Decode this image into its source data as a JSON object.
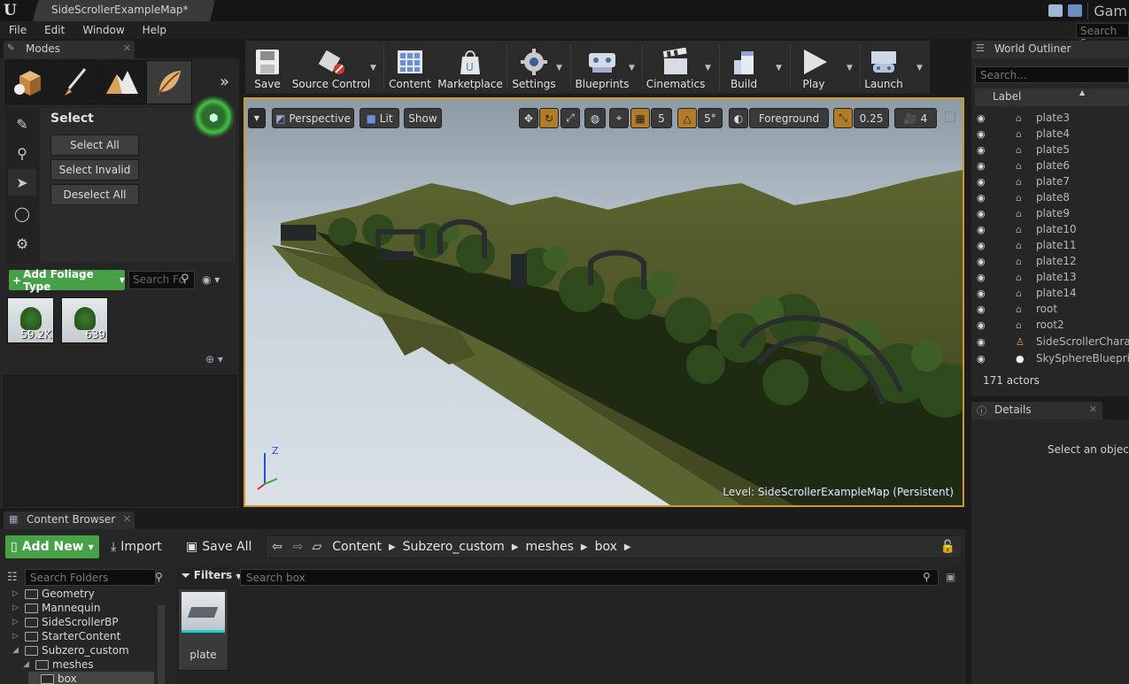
{
  "title_bar": {
    "logo_icon": "unreal-engine-logo",
    "document_tab": "SideScrollerExampleMap*",
    "game_label": "Gam"
  },
  "menu": [
    "File",
    "Edit",
    "Window",
    "Help"
  ],
  "search_for_placeholder": "Search Fo",
  "modes": {
    "tab_label": "Modes",
    "select_title": "Select",
    "buttons": [
      "Select All",
      "Select Invalid",
      "Deselect All"
    ],
    "add_foliage_label": "Add Foliage Type",
    "foliage_search_placeholder": "Search Fo",
    "foliage_items": [
      {
        "count": "59.2K"
      },
      {
        "count": "639"
      }
    ]
  },
  "toolbar": [
    {
      "label": "Save",
      "icon": "save-icon"
    },
    {
      "label": "Source Control",
      "icon": "source-control-icon"
    },
    {
      "label": "Content",
      "icon": "content-icon"
    },
    {
      "label": "Marketplace",
      "icon": "marketplace-icon"
    },
    {
      "label": "Settings",
      "icon": "settings-icon"
    },
    {
      "label": "Blueprints",
      "icon": "blueprints-icon"
    },
    {
      "label": "Cinematics",
      "icon": "cinematics-icon"
    },
    {
      "label": "Build",
      "icon": "build-icon"
    },
    {
      "label": "Play",
      "icon": "play-icon"
    },
    {
      "label": "Launch",
      "icon": "launch-icon"
    }
  ],
  "viewport": {
    "perspective": "Perspective",
    "lit": "Lit",
    "show": "Show",
    "grid_snap": "5",
    "rotation_snap": "5°",
    "layer": "Foreground",
    "scale_snap": "0.25",
    "camera_speed": "4",
    "level_label": "Level:",
    "level_name": "SideScrollerExampleMap (Persistent)",
    "axis_z": "Z"
  },
  "world_outliner": {
    "tab_label": "World Outliner",
    "search_placeholder": "Search...",
    "column_label": "Label",
    "items": [
      "plate3",
      "plate4",
      "plate5",
      "plate6",
      "plate7",
      "plate8",
      "plate9",
      "plate10",
      "plate11",
      "plate12",
      "plate13",
      "plate14",
      "root",
      "root2",
      "SideScrollerCharact",
      "SkySphereBlueprint"
    ],
    "count": "171 actors"
  },
  "details": {
    "tab_label": "Details",
    "message": "Select an object t"
  },
  "content_browser": {
    "tab_label": "Content Browser",
    "add_new": "Add New",
    "import": "Import",
    "save_all": "Save All",
    "breadcrumbs": [
      "Content",
      "Subzero_custom",
      "meshes",
      "box"
    ],
    "folder_search_placeholder": "Search Folders",
    "folders": [
      {
        "name": "Geometry",
        "depth": 0,
        "expanded": false
      },
      {
        "name": "Mannequin",
        "depth": 0,
        "expanded": false
      },
      {
        "name": "SideScrollerBP",
        "depth": 0,
        "expanded": false
      },
      {
        "name": "StarterContent",
        "depth": 0,
        "expanded": false
      },
      {
        "name": "Subzero_custom",
        "depth": 0,
        "expanded": true
      },
      {
        "name": "meshes",
        "depth": 1,
        "expanded": true
      },
      {
        "name": "box",
        "depth": 2,
        "expanded": false
      }
    ],
    "filters_label": "Filters",
    "asset_search_placeholder": "Search box",
    "assets": [
      "plate"
    ]
  },
  "colors": {
    "accent_green": "#46a046",
    "viewport_border": "#d09a22",
    "panel_bg": "#262626"
  }
}
